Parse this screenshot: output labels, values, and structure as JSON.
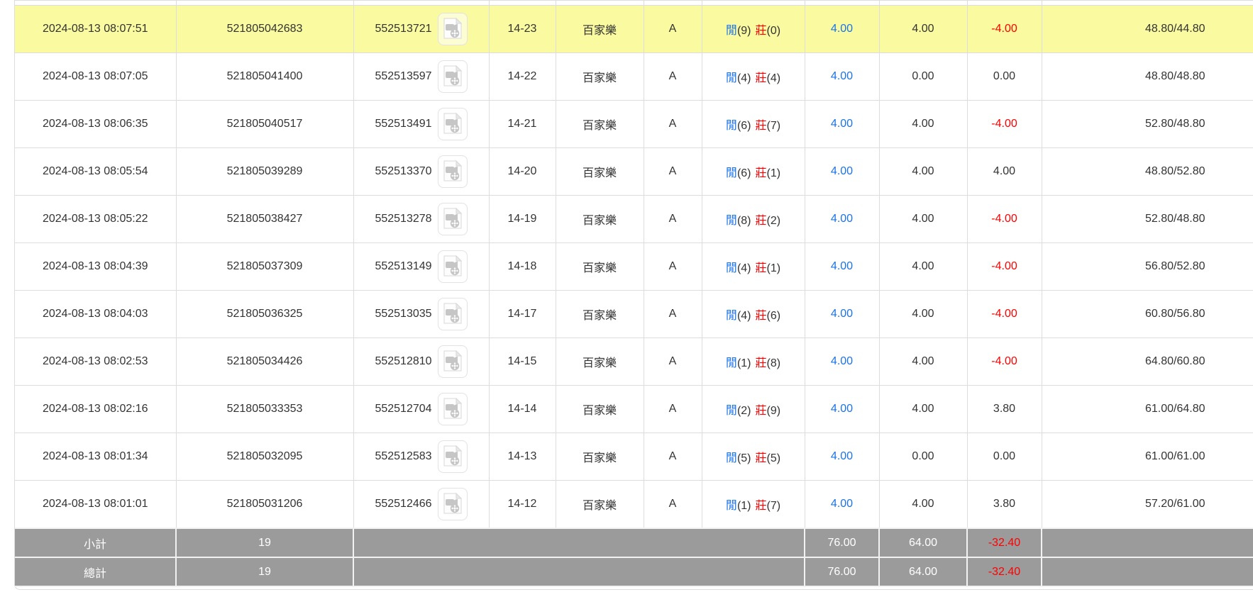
{
  "colors": {
    "highlight_yellow": "#fafaa0",
    "link_blue": "#1a73e8",
    "loss_red": "#ff0000",
    "summary_gray": "#9b9b9b",
    "text": "#333333",
    "border": "#dddddd"
  },
  "icons": {
    "video_replay": "video-file-icon"
  },
  "table": {
    "rows": [
      {
        "time": "2024-08-13 08:07:51",
        "order_no": "521805042683",
        "game_no": "552513721",
        "round": "14-23",
        "game": "百家樂",
        "table": "A",
        "player_label": "閒",
        "player_score": "(9)",
        "banker_label": "莊",
        "banker_score": "(0)",
        "bet": "4.00",
        "valid": "4.00",
        "win_loss": "-4.00",
        "balance": "48.80/44.80",
        "highlighted": true
      },
      {
        "time": "2024-08-13 08:07:05",
        "order_no": "521805041400",
        "game_no": "552513597",
        "round": "14-22",
        "game": "百家樂",
        "table": "A",
        "player_label": "閒",
        "player_score": "(4)",
        "banker_label": "莊",
        "banker_score": "(4)",
        "bet": "4.00",
        "valid": "0.00",
        "win_loss": "0.00",
        "balance": "48.80/48.80",
        "highlighted": false
      },
      {
        "time": "2024-08-13 08:06:35",
        "order_no": "521805040517",
        "game_no": "552513491",
        "round": "14-21",
        "game": "百家樂",
        "table": "A",
        "player_label": "閒",
        "player_score": "(6)",
        "banker_label": "莊",
        "banker_score": "(7)",
        "bet": "4.00",
        "valid": "4.00",
        "win_loss": "-4.00",
        "balance": "52.80/48.80",
        "highlighted": false
      },
      {
        "time": "2024-08-13 08:05:54",
        "order_no": "521805039289",
        "game_no": "552513370",
        "round": "14-20",
        "game": "百家樂",
        "table": "A",
        "player_label": "閒",
        "player_score": "(6)",
        "banker_label": "莊",
        "banker_score": "(1)",
        "bet": "4.00",
        "valid": "4.00",
        "win_loss": "4.00",
        "balance": "48.80/52.80",
        "highlighted": false
      },
      {
        "time": "2024-08-13 08:05:22",
        "order_no": "521805038427",
        "game_no": "552513278",
        "round": "14-19",
        "game": "百家樂",
        "table": "A",
        "player_label": "閒",
        "player_score": "(8)",
        "banker_label": "莊",
        "banker_score": "(2)",
        "bet": "4.00",
        "valid": "4.00",
        "win_loss": "-4.00",
        "balance": "52.80/48.80",
        "highlighted": false
      },
      {
        "time": "2024-08-13 08:04:39",
        "order_no": "521805037309",
        "game_no": "552513149",
        "round": "14-18",
        "game": "百家樂",
        "table": "A",
        "player_label": "閒",
        "player_score": "(4)",
        "banker_label": "莊",
        "banker_score": "(1)",
        "bet": "4.00",
        "valid": "4.00",
        "win_loss": "-4.00",
        "balance": "56.80/52.80",
        "highlighted": false
      },
      {
        "time": "2024-08-13 08:04:03",
        "order_no": "521805036325",
        "game_no": "552513035",
        "round": "14-17",
        "game": "百家樂",
        "table": "A",
        "player_label": "閒",
        "player_score": "(4)",
        "banker_label": "莊",
        "banker_score": "(6)",
        "bet": "4.00",
        "valid": "4.00",
        "win_loss": "-4.00",
        "balance": "60.80/56.80",
        "highlighted": false
      },
      {
        "time": "2024-08-13 08:02:53",
        "order_no": "521805034426",
        "game_no": "552512810",
        "round": "14-15",
        "game": "百家樂",
        "table": "A",
        "player_label": "閒",
        "player_score": "(1)",
        "banker_label": "莊",
        "banker_score": "(8)",
        "bet": "4.00",
        "valid": "4.00",
        "win_loss": "-4.00",
        "balance": "64.80/60.80",
        "highlighted": false
      },
      {
        "time": "2024-08-13 08:02:16",
        "order_no": "521805033353",
        "game_no": "552512704",
        "round": "14-14",
        "game": "百家樂",
        "table": "A",
        "player_label": "閒",
        "player_score": "(2)",
        "banker_label": "莊",
        "banker_score": "(9)",
        "bet": "4.00",
        "valid": "4.00",
        "win_loss": "3.80",
        "balance": "61.00/64.80",
        "highlighted": false
      },
      {
        "time": "2024-08-13 08:01:34",
        "order_no": "521805032095",
        "game_no": "552512583",
        "round": "14-13",
        "game": "百家樂",
        "table": "A",
        "player_label": "閒",
        "player_score": "(5)",
        "banker_label": "莊",
        "banker_score": "(5)",
        "bet": "4.00",
        "valid": "0.00",
        "win_loss": "0.00",
        "balance": "61.00/61.00",
        "highlighted": false
      },
      {
        "time": "2024-08-13 08:01:01",
        "order_no": "521805031206",
        "game_no": "552512466",
        "round": "14-12",
        "game": "百家樂",
        "table": "A",
        "player_label": "閒",
        "player_score": "(1)",
        "banker_label": "莊",
        "banker_score": "(7)",
        "bet": "4.00",
        "valid": "4.00",
        "win_loss": "3.80",
        "balance": "57.20/61.00",
        "highlighted": false
      }
    ],
    "summary": [
      {
        "label": "小計",
        "count": "19",
        "bet_total": "76.00",
        "valid_total": "64.00",
        "win_loss_total": "-32.40"
      },
      {
        "label": "總計",
        "count": "19",
        "bet_total": "76.00",
        "valid_total": "64.00",
        "win_loss_total": "-32.40"
      }
    ]
  }
}
